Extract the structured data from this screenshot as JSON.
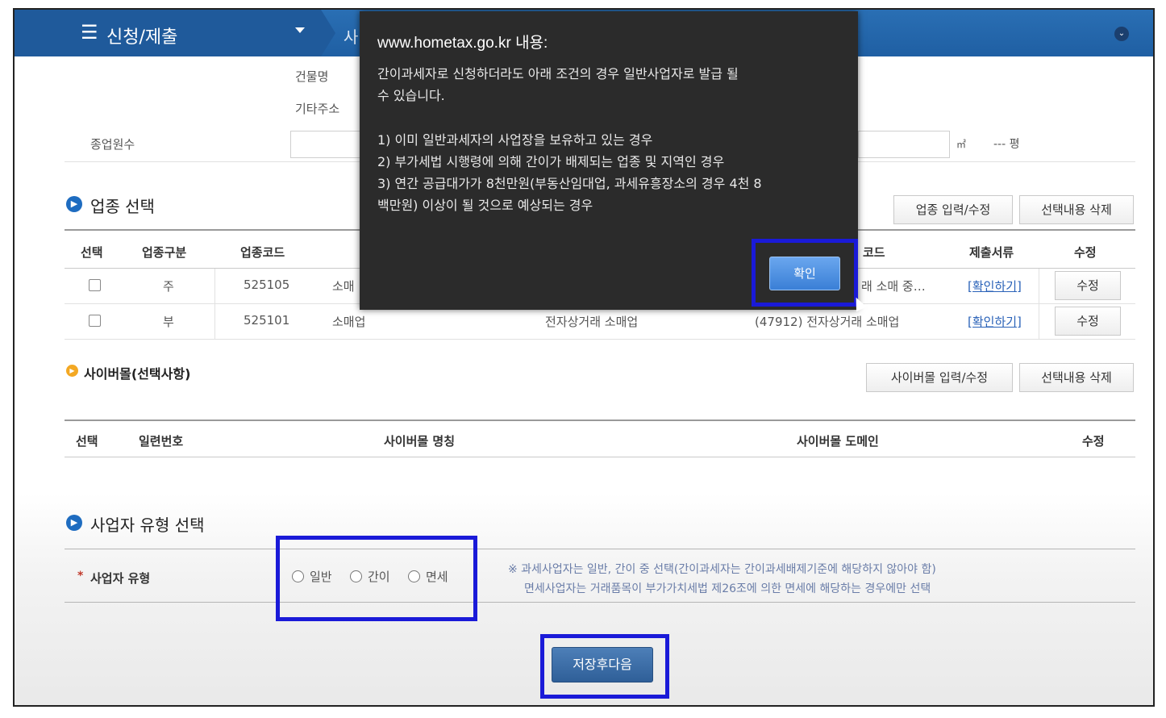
{
  "header": {
    "menu_icon": "☰",
    "menu_title": "신청/제출",
    "next_tab": "사",
    "collapse_icon": "chevron-down-circle-icon"
  },
  "form": {
    "building_label": "건물명",
    "other_address_label": "기타주소",
    "employees_label": "종업원수",
    "area_unit": "㎡",
    "pyeong_value": "--- 평"
  },
  "industry": {
    "title": "업종 선택",
    "btn_edit": "업종 입력/수정",
    "btn_delete": "선택내용 삭제",
    "headers": [
      "선택",
      "업종구분",
      "업종코드",
      "코드",
      "제출서류",
      "수정"
    ],
    "rows": [
      {
        "type": "주",
        "code": "525105",
        "name": "소매",
        "detail": "",
        "ksic": "래 소매 중…",
        "doc": "[확인하기]",
        "edit": "수정"
      },
      {
        "type": "부",
        "code": "525101",
        "name": "소매업",
        "detail": "전자상거래 소매업",
        "ksic": "(47912) 전자상거래 소매업",
        "doc": "[확인하기]",
        "edit": "수정"
      }
    ]
  },
  "cyber": {
    "title": "사이버몰(선택사항)",
    "btn_edit": "사이버몰 입력/수정",
    "btn_delete": "선택내용 삭제",
    "headers": [
      "선택",
      "일련번호",
      "사이버몰 명칭",
      "사이버몰 도메인",
      "수정"
    ]
  },
  "biz_type": {
    "title": "사업자 유형 선택",
    "label_star": "*",
    "label": "사업자 유형",
    "options": [
      "일반",
      "간이",
      "면세"
    ],
    "note1": "※ 과세사업자는 일반, 간이 중 선택(간이과세자는 간이과세배제기준에 해당하지 않아야 함)",
    "note2": "면세사업자는 거래품목이 부가가치세법 제26조에 의한 면세에 해당하는 경우에만 선택"
  },
  "save_button": "저장후다음",
  "dialog": {
    "title": "www.hometax.go.kr 내용:",
    "line1": "간이과세자로 신청하더라도 아래 조건의 경우 일반사업자로 발급 될",
    "line2": "수 있습니다.",
    "cond1": "1) 이미 일반과세자의 사업장을 보유하고 있는 경우",
    "cond2": "2) 부가세법 시행령에 의해 간이가 배제되는 업종 및 지역인 경우",
    "cond3a": "3) 연간 공급대가가 8천만원(부동산임대업, 과세유흥장소의 경우 4천 8",
    "cond3b": "백만원) 이상이 될 것으로 예상되는 경우",
    "ok": "확인"
  },
  "colors": {
    "header_blue": "#1f5fa3",
    "highlight_box": "#1a1ad8",
    "dialog_bg": "#2b2b2b",
    "link_blue": "#2a62b8"
  }
}
